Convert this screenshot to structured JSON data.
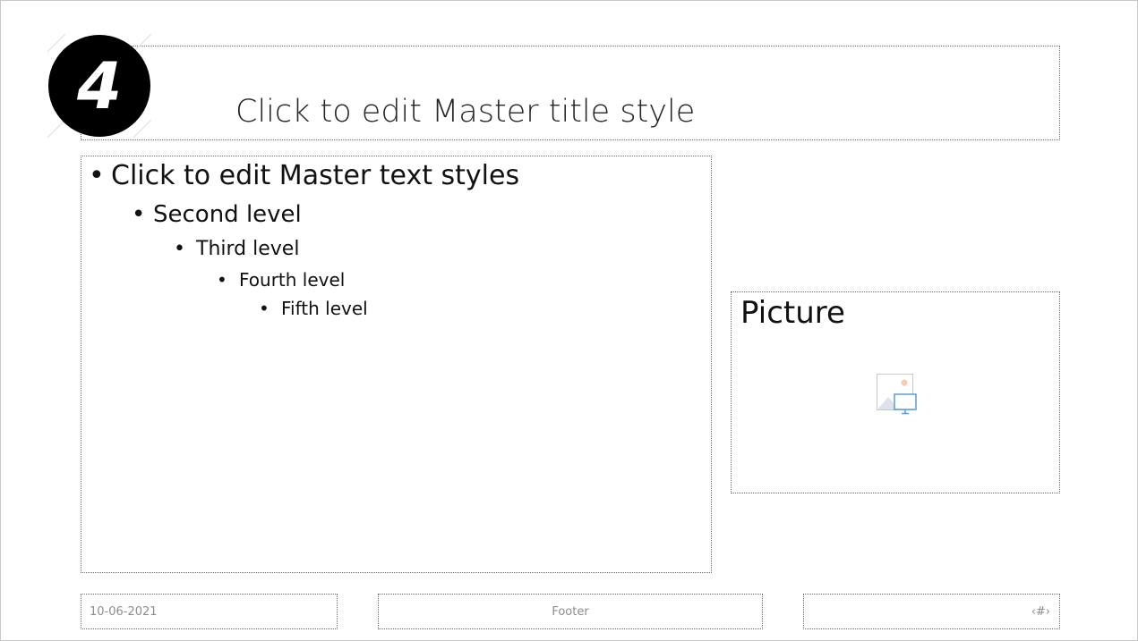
{
  "badge": {
    "number": "4"
  },
  "title": {
    "text": "Click to edit Master title style"
  },
  "body": {
    "bullet": "•",
    "levels": [
      "Click to edit Master text styles",
      "Second level",
      "Third level",
      "Fourth level",
      "Fifth level"
    ]
  },
  "picture": {
    "label": "Picture",
    "icon": "picture-placeholder-icon"
  },
  "footer": {
    "date": "10-06-2021",
    "text": "Footer",
    "slide_number": "‹#›"
  },
  "colors": {
    "badge_background": "#000000",
    "placeholder_border": "#6b6b6b",
    "footer_text": "#8c8c8c",
    "icon_blue": "#5b9bd5",
    "icon_sun": "#f8cbad"
  }
}
